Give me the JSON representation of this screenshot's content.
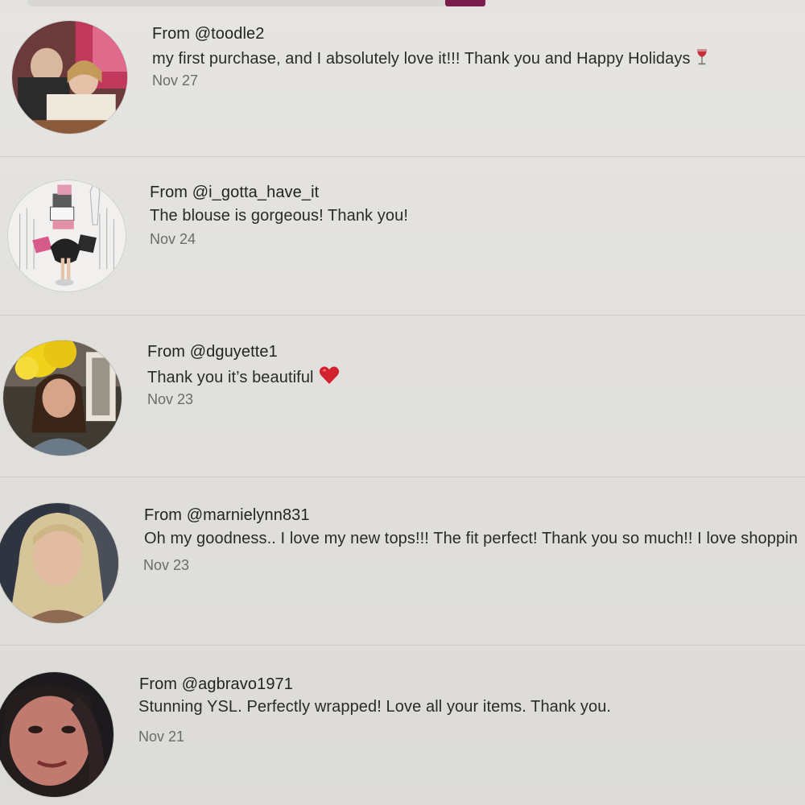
{
  "comments": [
    {
      "from": "From @toodle2",
      "message": "my first purchase, and I absolutely love it!!! Thank you and Happy Holidays",
      "emoji": "wine-glass-icon",
      "date": "Nov 27"
    },
    {
      "from": "From @i_gotta_have_it",
      "message": "The blouse is gorgeous! Thank you!",
      "date": "Nov 24"
    },
    {
      "from": "From @dguyette1",
      "message": "Thank you it’s beautiful",
      "emoji": "red-heart-icon",
      "date": "Nov 23"
    },
    {
      "from": "From @marnielynn831",
      "message": "Oh my goodness.. I love my new tops!!! The fit perfect! Thank you so much!! I love shoppin",
      "date": "Nov 23"
    },
    {
      "from": "From @agbravo1971",
      "message": "Stunning YSL. Perfectly wrapped! Love all your items. Thank you.",
      "date": "Nov 21"
    }
  ],
  "colors": {
    "background": "#e2e1dd",
    "accent": "#7a1f4c",
    "heart": "#d2222d"
  }
}
